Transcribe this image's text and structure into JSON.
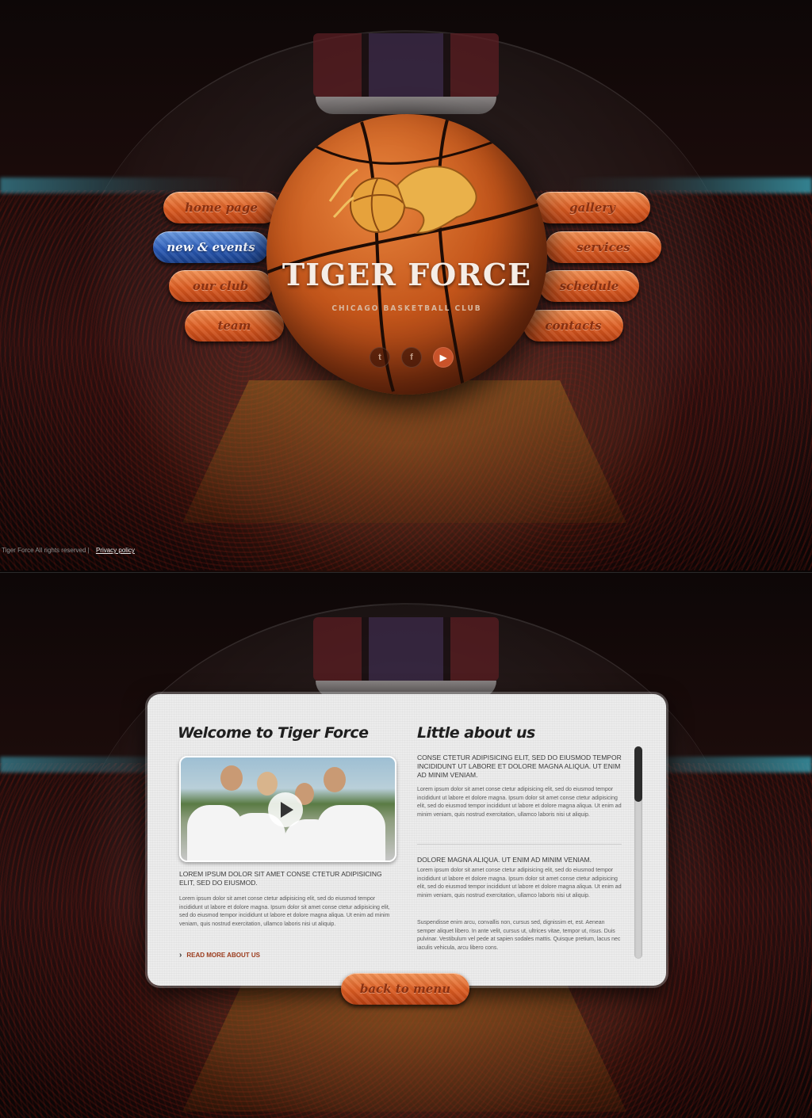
{
  "nav": {
    "left": [
      {
        "label": "home page",
        "active": false
      },
      {
        "label": "new & events",
        "active": true
      },
      {
        "label": "our club",
        "active": false
      },
      {
        "label": "team",
        "active": false
      }
    ],
    "right": [
      {
        "label": "gallery"
      },
      {
        "label": "services"
      },
      {
        "label": "schedule"
      },
      {
        "label": "contacts"
      }
    ]
  },
  "brand": {
    "title": "TIGER FORCE",
    "subtitle": "CHICAGO BASKETBALL CLUB"
  },
  "social": [
    {
      "icon": "twitter-icon",
      "glyph": "t"
    },
    {
      "icon": "facebook-icon",
      "glyph": "f"
    },
    {
      "icon": "youtube-icon",
      "glyph": "▶"
    }
  ],
  "footer": {
    "copyright": "Tiger Force All rights reserved  |",
    "privacy": "Privacy policy"
  },
  "welcome": {
    "heading": "Welcome to Tiger Force",
    "caps": "LOREM IPSUM DOLOR SIT AMET CONSE CTETUR ADIPISICING ELIT, SED DO EIUSMOD.",
    "body": "Lorem ipsum dolor sit amet conse ctetur adipisicing elit, sed do eiusmod tempor incididunt ut labore et dolore magna. Ipsum dolor sit amet conse ctetur adipisicing elit, sed do eiusmod tempor incididunt ut labore et dolore magna aliqua. Ut enim ad minim veniam, quis nostrud exercitation, ullamco laboris nisi ut aliquip.",
    "read_more": "READ MORE ABOUT US"
  },
  "about": {
    "heading": "Little about us",
    "caps1": "CONSE CTETUR ADIPISICING ELIT, SED DO EIUSMOD TEMPOR INCIDIDUNT UT LABORE ET DOLORE MAGNA ALIQUA. UT ENIM AD MINIM VENIAM.",
    "body1": "Lorem ipsum dolor sit amet conse ctetur adipisicing elit, sed do eiusmod tempor incididunt ut labore et dolore magna. Ipsum dolor sit amet conse ctetur adipisicing elit, sed do eiusmod tempor incididunt ut labore et dolore magna aliqua. Ut enim ad minim veniam, quis nostrud exercitation, ullamco laboris nisi ut aliquip.",
    "caps2": "DOLORE MAGNA ALIQUA. UT ENIM AD MINIM VENIAM.",
    "body2": "Lorem ipsum dolor sit amet conse ctetur adipisicing elit, sed do eiusmod tempor incididunt ut labore et dolore magna. Ipsum dolor sit amet conse ctetur adipisicing elit, sed do eiusmod tempor incididunt ut labore et dolore magna aliqua. Ut enim ad minim veniam, quis nostrud exercitation, ullamco laboris nisi ut aliquip.",
    "body3": "Suspendisse enim arcu, convallis non, cursus sed, dignissim et, est. Aenean semper aliquet libero. In ante velit, cursus ut, ultrices vitae, tempor ut, risus. Duis pulvinar. Vestibulum vel pede at sapien sodales mattis. Quisque pretium, lacus nec iaculis vehicula, arcu libero cons."
  },
  "back_button": "back to menu",
  "colors": {
    "accent_orange": "#db5c22",
    "active_blue": "#2c5cb8",
    "read_more": "#9b3b1c"
  }
}
